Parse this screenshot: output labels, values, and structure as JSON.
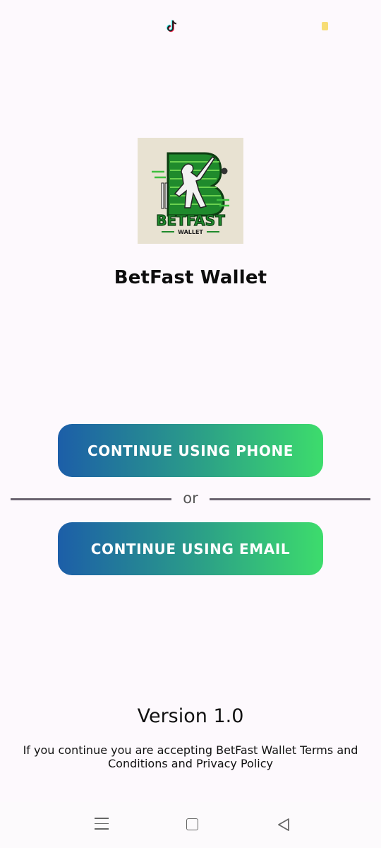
{
  "status_bar": {
    "icons": [
      "tiktok-icon",
      "battery-icon"
    ]
  },
  "logo": {
    "brand": "BETFAST",
    "sub": "WALLET"
  },
  "app_title": "BetFast Wallet",
  "buttons": {
    "phone": "CONTINUE USING PHONE",
    "email": "CONTINUE USING EMAIL"
  },
  "divider_text": "or",
  "version": "Version 1.0",
  "terms": "If you continue you are accepting BetFast Wallet Terms and Conditions and Privacy Policy",
  "nav": {
    "icons": [
      "menu-icon",
      "home-icon",
      "back-icon"
    ]
  },
  "colors": {
    "gradient_start": "#1c5ea8",
    "gradient_end": "#3ddc6c",
    "background": "#fdf9fd"
  }
}
